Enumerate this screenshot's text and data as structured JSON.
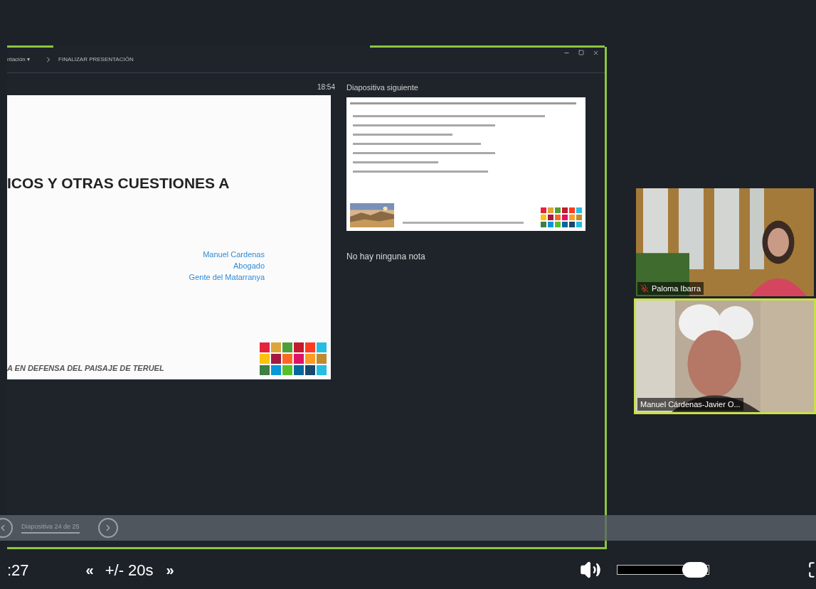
{
  "presenter_window": {
    "toolbar": [
      {
        "label": "ntación ▾"
      },
      {
        "label": "FINALIZAR PRESENTACIÓN"
      }
    ],
    "timer": "18:54",
    "current_slide": {
      "title": "ICOS Y OTRAS CUESTIONES A",
      "author_lines": [
        "Manuel Cardenas",
        "Abogado",
        "Gente del Matarranya"
      ],
      "footer": "A EN DEFENSA DEL PAISAJE DE TERUEL"
    },
    "next_slide_label": "Diapositiva siguiente",
    "notes": "No hay ninguna nota"
  },
  "slide_navigation": {
    "counter": "Diapositiva 24 de 25"
  },
  "participants": [
    {
      "name": "Paloma Ibarra",
      "muted": true,
      "speaking": false
    },
    {
      "name": "Manuel Cárdenas-Javier O...",
      "muted": false,
      "speaking": true
    }
  ],
  "player": {
    "time": ":27",
    "rewind": "«",
    "skip_label": "+/- 20s",
    "forward": "»",
    "volume": {
      "level": 0.85
    }
  }
}
